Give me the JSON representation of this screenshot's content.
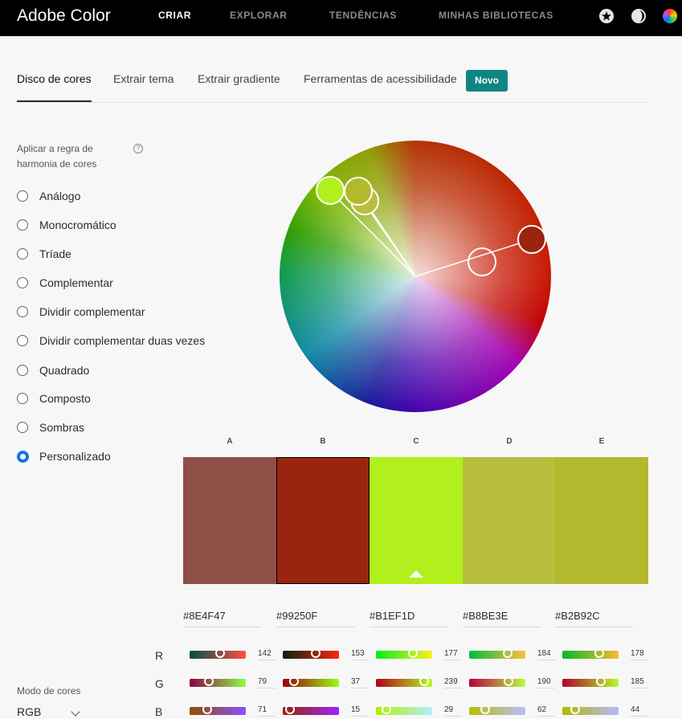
{
  "header": {
    "brand": "Adobe Color",
    "nav": [
      "CRIAR",
      "EXPLORAR",
      "TENDÊNCIAS",
      "MINHAS BIBLIOTECAS"
    ],
    "icons": [
      "star-icon",
      "moon-icon",
      "color-wheel-icon"
    ]
  },
  "tabs": {
    "items": [
      "Disco de cores",
      "Extrair tema",
      "Extrair gradiente",
      "Ferramentas de acessibilidade"
    ],
    "active": "Disco de cores",
    "badge": "Novo"
  },
  "harmony": {
    "title": "Aplicar a regra de harmonia de cores",
    "help_glyph": "?",
    "rules": [
      "Análogo",
      "Monocromático",
      "Tríade",
      "Complementar",
      "Dividir complementar",
      "Dividir complementar duas vezes",
      "Quadrado",
      "Composto",
      "Sombras",
      "Personalizado"
    ],
    "selected": "Personalizado"
  },
  "swatches": [
    {
      "label": "A",
      "hex": "#8E4F47",
      "r": "142",
      "g": "79",
      "b": "71"
    },
    {
      "label": "B",
      "hex": "#99250F",
      "r": "153",
      "g": "37",
      "b": "15"
    },
    {
      "label": "C",
      "hex": "#B1EF1D",
      "r": "177",
      "g": "239",
      "b": "29"
    },
    {
      "label": "D",
      "hex": "#B8BE3E",
      "r": "184",
      "g": "190",
      "b": "62"
    },
    {
      "label": "E",
      "hex": "#B2B92C",
      "r": "178",
      "g": "185",
      "b": "44"
    }
  ],
  "selected_swatch": "B",
  "channels": [
    "R",
    "G",
    "B"
  ],
  "color_mode": {
    "label": "Modo de cores",
    "value": "RGB"
  }
}
